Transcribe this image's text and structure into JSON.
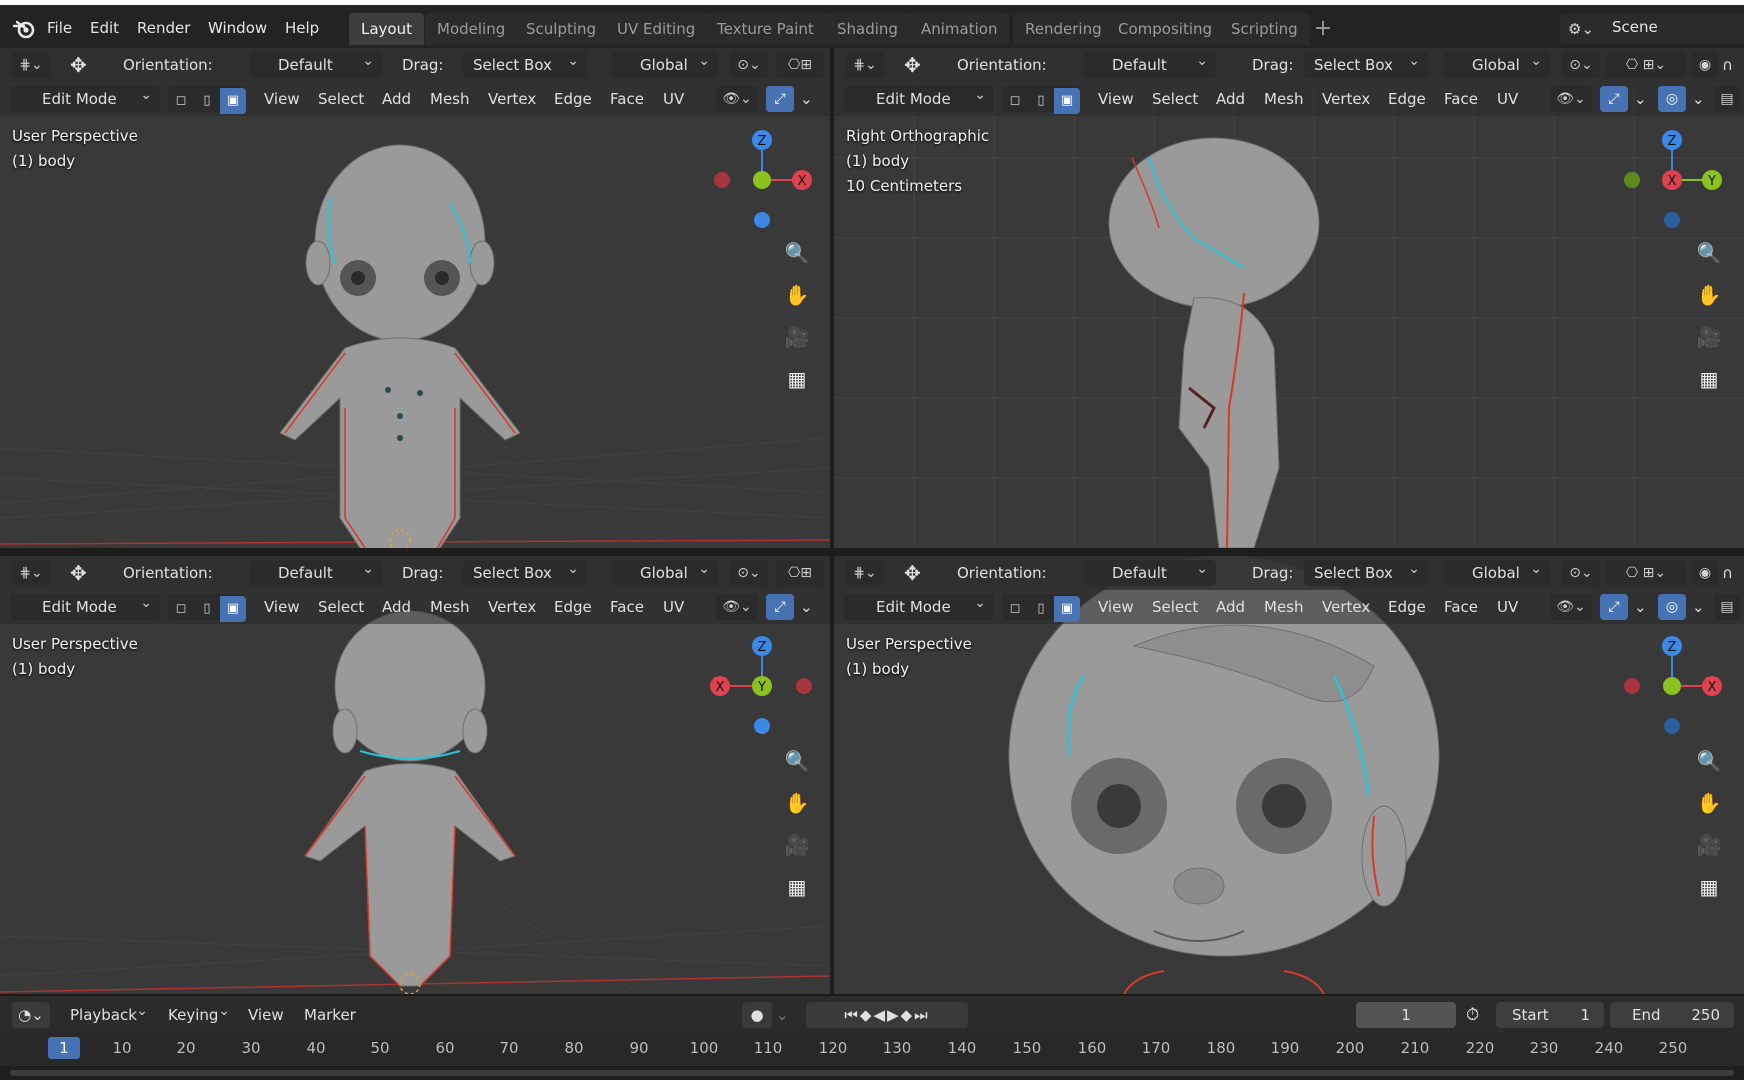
{
  "menubar": {
    "items": [
      "File",
      "Edit",
      "Render",
      "Window",
      "Help"
    ],
    "workspace_tabs": [
      "Layout",
      "Modeling",
      "Sculpting",
      "UV Editing",
      "Texture Paint",
      "Shading",
      "Animation",
      "Rendering",
      "Compositing",
      "Scripting"
    ],
    "active_tab": "Layout",
    "add_tab": "+",
    "scene": "Scene"
  },
  "toolbar": {
    "orientation_label": "Orientation:",
    "orientation_value": "Default",
    "drag_label": "Drag:",
    "drag_value": "Select Box",
    "transform_value": "Global",
    "mode": "Edit Mode",
    "menus": [
      "View",
      "Select",
      "Add",
      "Mesh",
      "Vertex",
      "Edge",
      "Face",
      "UV"
    ]
  },
  "viewports": {
    "top_left": {
      "view": "User Perspective",
      "object": "(1) body",
      "extra": ""
    },
    "top_right": {
      "view": "Right Orthographic",
      "object": "(1) body",
      "extra": "10 Centimeters"
    },
    "bottom_left": {
      "view": "User Perspective",
      "object": "(1) body",
      "extra": ""
    },
    "bottom_right": {
      "view": "User Perspective",
      "object": "(1) body",
      "extra": ""
    }
  },
  "gizmo_axes": {
    "top_left": [
      "Z",
      "X"
    ],
    "top_right": [
      "Z",
      "X",
      "Y"
    ],
    "bottom_left": [
      "Z",
      "X",
      "Y"
    ],
    "bottom_right": [
      "Z",
      "X"
    ]
  },
  "colors": {
    "axis_x": "#e0414f",
    "axis_y": "#8bc21f",
    "axis_z": "#3b88e6",
    "accent_blue": "#4772b3",
    "edge_seam": "#d63a2a",
    "edge_sharp": "#29c4d8"
  },
  "timeline": {
    "menus": [
      "Playback",
      "Keying",
      "View",
      "Marker"
    ],
    "current_frame": "1",
    "start_label": "Start",
    "start_value": "1",
    "end_label": "End",
    "end_value": "250",
    "ruler_current": "1",
    "ruler_ticks": [
      "10",
      "20",
      "30",
      "40",
      "50",
      "60",
      "70",
      "80",
      "90",
      "100",
      "110",
      "120",
      "130",
      "140",
      "150",
      "160",
      "170",
      "180",
      "190",
      "200",
      "210",
      "220",
      "230",
      "240",
      "250"
    ]
  },
  "icons": {
    "blender_logo": "blender-logo-icon",
    "zoom": "magnifier-plus-icon",
    "pan": "hand-icon",
    "camera": "camera-icon",
    "perspective": "grid-perspective-icon"
  }
}
